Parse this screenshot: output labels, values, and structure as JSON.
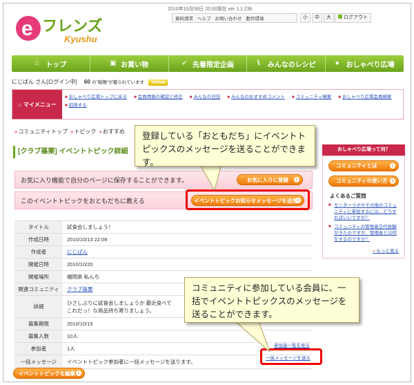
{
  "header": {
    "logo_main": "フレンズ",
    "logo_sub": "Kyushu",
    "logo_letter": "e",
    "date_version": "2010年10月08日 20:00現在 ver 1.1.23b",
    "util_links": [
      "資料請求",
      "ヘルプ",
      "お問い合わせ",
      "動作環境"
    ],
    "text_sizes": [
      "小",
      "中",
      "大"
    ],
    "logout_label": "ログアウト"
  },
  "nav": {
    "items": [
      {
        "label": "トップ",
        "icon": "home-icon"
      },
      {
        "label": "お買い物",
        "icon": "cart-icon"
      },
      {
        "label": "先着限定企画",
        "icon": "runner-icon"
      },
      {
        "label": "みんなのレシピ",
        "icon": "fork-knife-icon"
      },
      {
        "label": "おしゃべり広場",
        "icon": "chat-bubble-icon"
      }
    ]
  },
  "user": {
    "name": "にじばん",
    "status": "さん[ログイン中]",
    "points": "60",
    "points_note": "の\"稲穂\"が獲られています",
    "badge": "Yellow"
  },
  "mymenu": {
    "label": "マイメニュー",
    "links": [
      "おしゃべり広場トップに戻る",
      "会員情報の確認と修正",
      "みんなの日記",
      "みんなのおすすめコメント",
      "コミュニティ検索",
      "おしゃべり広場会員検索",
      "招待する"
    ]
  },
  "breadcrumb": [
    "コミュニティトップ",
    "トピック",
    "おすすめ"
  ],
  "page": {
    "title": "[クラブ篠栗] イベントトピック詳細",
    "favorite_text": "お気に入り機能で自分のページに保存することができます。",
    "favorite_button": "お気に入りに登録",
    "notify_text": "このイベントトピックをおともだちに教える",
    "notify_button": "イベントトピックお知らせメッセージを送信",
    "edit_button": "イベントトピックを編集"
  },
  "details": [
    {
      "label": "タイトル",
      "value": "試食会しましょう！"
    },
    {
      "label": "作成日時",
      "value": "2010/10/13 22:08"
    },
    {
      "label": "作成者",
      "value": "にじばん",
      "link": true
    },
    {
      "label": "開催日時",
      "value": "2010/10/20"
    },
    {
      "label": "開催場所",
      "value": "福岡県 私んち"
    },
    {
      "label": "関連コミュニティ",
      "value": "クラブ篠栗",
      "link": true
    },
    {
      "label": "詳細",
      "value": "ひさしぶりに試食会しましょうか 最近食べてこれだっ！な商品持ち寄りましょう。"
    },
    {
      "label": "募集期限",
      "value": "2010/10/15"
    },
    {
      "label": "募集人数",
      "value": "10人"
    },
    {
      "label": "参加者",
      "value": "1人"
    },
    {
      "label": "一括メッセージ",
      "value": "イベントトピック参加者に一括メッセージを送ります。"
    }
  ],
  "participants_link": "参加者一覧を見る",
  "bulk_message_link": "一括メッセージを送る",
  "sidebar": {
    "head": "おしゃべり広場って何？",
    "buttons": [
      "コミュニティとは",
      "コミュニティの使い方"
    ],
    "faq_title": "よくあるご質問",
    "faq": [
      "モニターラボやその他のコミュニティに参加するには、どうすればいいですか？",
      "コミュニティの管理者交代依頼がきたのですが、管理者とは何をするのですか？"
    ],
    "more": "もっと見る"
  },
  "callouts": {
    "top": "登録している「おともだち」にイベントトピックスのメッセージを送ることができます。",
    "bottom": "コミュニティに参加している会員に、一括でイベントトピックスのメッセージを送ることができます。"
  },
  "colors": {
    "brand_green": "#6aa31c",
    "brand_pink": "#c8284a",
    "button_orange": "#ee7a0a",
    "highlight_red": "#e00000",
    "callout_yellow": "#ffffd6"
  }
}
